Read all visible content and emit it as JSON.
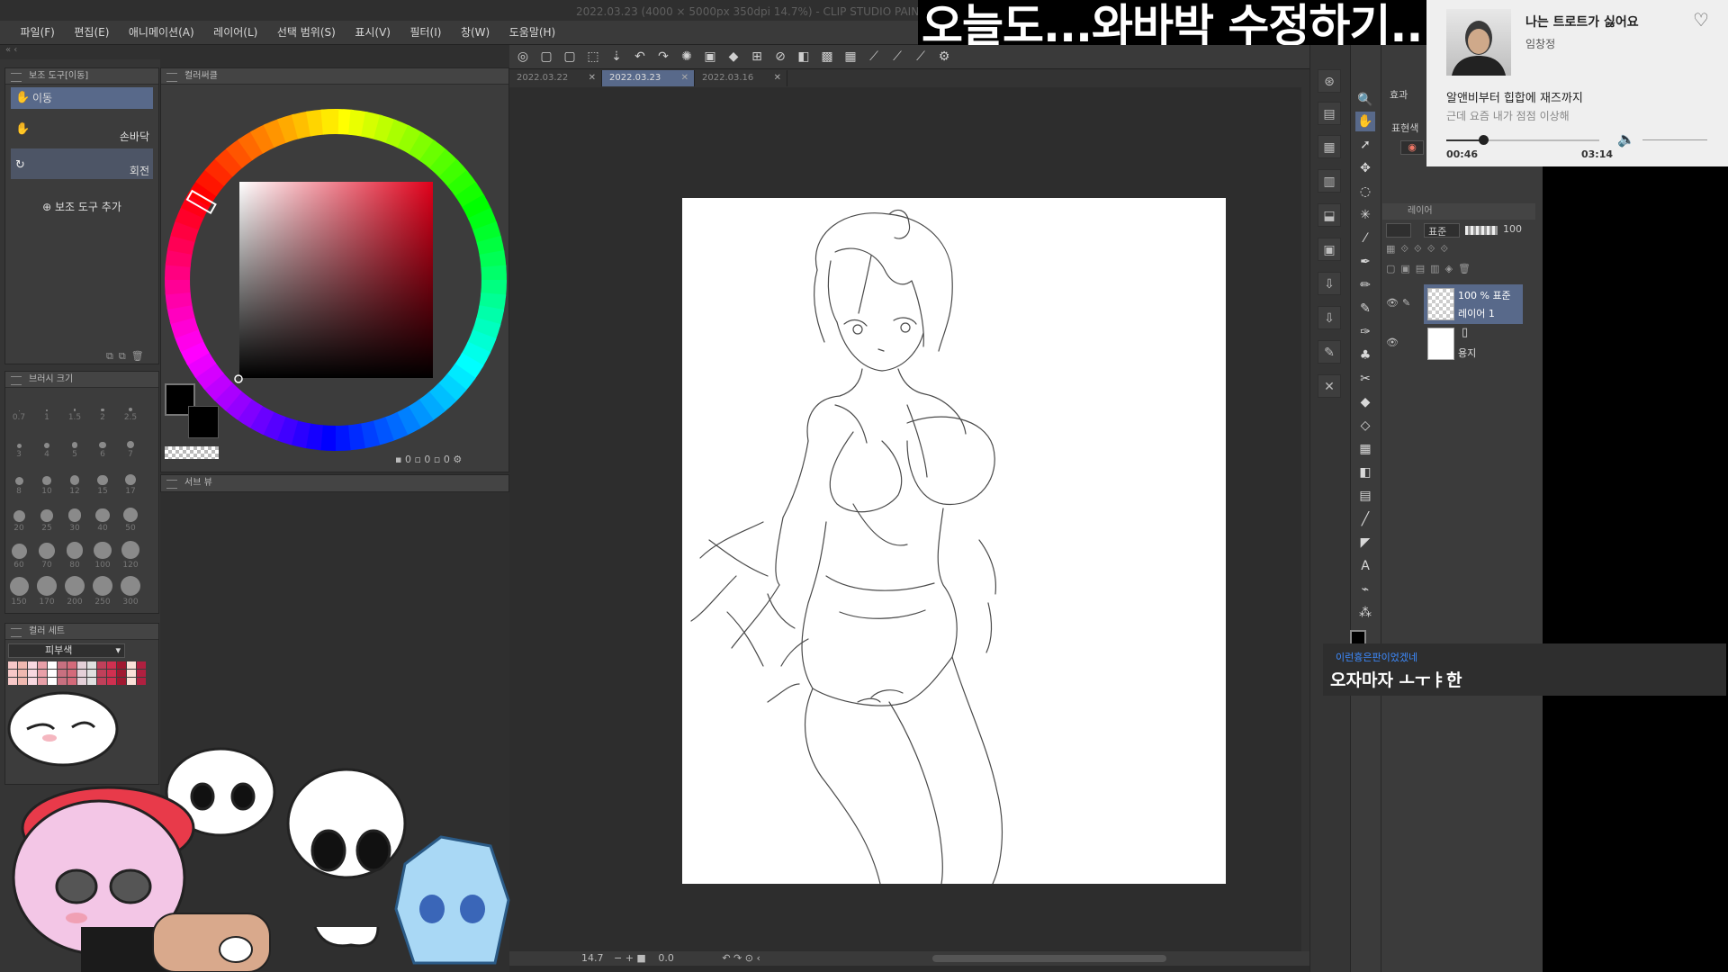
{
  "window_title": "2022.03.23 (4000 × 5000px 350dpi 14.7%) - CLIP STUDIO PAINT",
  "menu": [
    "파일(F)",
    "편집(E)",
    "애니메이션(A)",
    "레이어(L)",
    "선택 범위(S)",
    "표시(V)",
    "필터(I)",
    "창(W)",
    "도움말(H)"
  ],
  "banner_text": "오늘도...와바박 수정하기...",
  "subtool_panel": {
    "title": "보조 도구[이동]",
    "items": [
      {
        "label": "이동",
        "icon": "hand-icon",
        "selected": true
      },
      {
        "label": "손바닥",
        "icon": "hand-icon",
        "selected": false
      },
      {
        "label": "회전",
        "icon": "rotate-icon",
        "selected": false
      }
    ],
    "add_label": "보조 도구 추가"
  },
  "color_panel": {
    "title": "컬러써클",
    "field_values": [
      "0",
      "0",
      "0"
    ]
  },
  "sub_view": {
    "title": "서브 뷰"
  },
  "brush_size_panel": {
    "title": "브러시 크기",
    "sizes": [
      "0.7",
      "1",
      "1.5",
      "2",
      "2.5",
      "3",
      "4",
      "5",
      "6",
      "7",
      "8",
      "10",
      "12",
      "15",
      "17",
      "20",
      "25",
      "30",
      "40",
      "50",
      "60",
      "70",
      "80",
      "100",
      "120",
      "150",
      "170",
      "200",
      "250",
      "300"
    ]
  },
  "color_set_panel": {
    "title": "컬러 세트",
    "selected_set": "피부색"
  },
  "document_tabs": [
    {
      "label": "2022.03.22",
      "active": false
    },
    {
      "label": "2022.03.23",
      "active": true
    },
    {
      "label": "2022.03.16",
      "active": false
    }
  ],
  "status_bar": {
    "zoom": "14.7",
    "angle": "0.0"
  },
  "right_panel": {
    "effect_tab": "효과",
    "expression_label": "표현색",
    "layer_panel_title": "레이어",
    "blend_mode": "표준",
    "opacity": "100",
    "layers": [
      {
        "meta": "100 % 표준",
        "name": "레이어 1",
        "selected": true
      },
      {
        "meta": "",
        "name": "용지",
        "selected": false
      }
    ]
  },
  "music": {
    "title": "나는 트로트가 싫어요",
    "artist": "임창정",
    "lyric_line1": "알앤비부터 힙합에 재즈까지",
    "lyric_line2": "근데 요즘 내가 점점 이상해",
    "current_time": "00:46",
    "total_time": "03:14",
    "progress": 0.24,
    "volume": 0.5
  },
  "chat": {
    "username": "이런흉은판이었겠네",
    "message": "오자마자 ㅗㅜㅑ한"
  },
  "colors": {
    "accent_selection": "#58698a",
    "banner_bg": "#000000",
    "music_bg": "#efefef"
  }
}
